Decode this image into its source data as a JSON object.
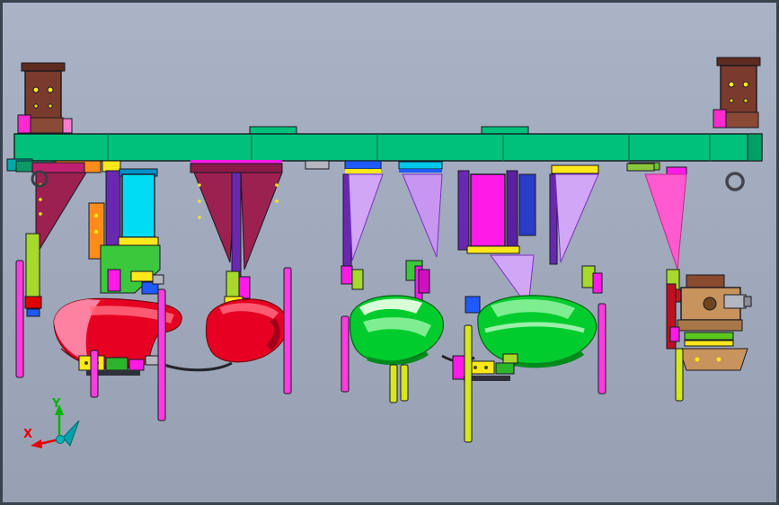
{
  "viewport": {
    "width": "867",
    "height": "562",
    "background_top": "#aab3c6",
    "background_bottom": "#96a0b2",
    "frame_color": "#39434e"
  },
  "axis_triad": {
    "x_label": "X",
    "y_label": "Y",
    "x_color": "#e60000",
    "y_color": "#00b400",
    "z_color": "#00a2aa"
  },
  "palette": {
    "beam_green": "#00c17c",
    "beam_green_dark": "#007a4e",
    "beam_teal_end": "#00a8a8",
    "bracket_brown": "#7b3b2c",
    "bracket_brown_dark": "#5e2b20",
    "maroon_gusset": "#9c2050",
    "violet_gusset": "#d2a6f6",
    "violet_gusset_alt": "#c896f0",
    "pink_gusset": "#ff5ad0",
    "purple_plate": "#6a28b0",
    "indigo_block": "#2a3cc8",
    "magenta": "#ff1ae8",
    "cyan_cylinder": "#00dcf4",
    "blue_cap": "#1e5aff",
    "orange_bracket": "#ff8c1a",
    "yellow_plate": "#ffe81a",
    "lime_plate": "#a6d92c",
    "green_bracket": "#3cc83c",
    "pin_pink": "#ff3ce0",
    "pin_lime": "#d6e81a",
    "panel_red": "#e60022",
    "panel_red_light": "#ff6a7e",
    "panel_red_pink": "#ff8fae",
    "panel_red_dark": "#a00018",
    "panel_green": "#00cc2e",
    "panel_green_light": "#8df29c",
    "panel_green_pale": "#d9ffd9",
    "panel_green_dark": "#008a1e",
    "tan_clamp": "#c8935c",
    "steel_gray": "#b4b6c0",
    "hose_dark": "#23232c"
  }
}
